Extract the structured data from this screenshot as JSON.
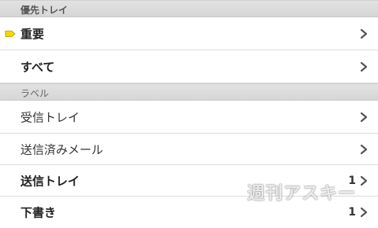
{
  "sections": {
    "priority_header": "優先トレイ",
    "label_header": "ラベル"
  },
  "rows": [
    {
      "label": "重要",
      "count": ""
    },
    {
      "label": "すべて",
      "count": ""
    },
    {
      "label": "受信トレイ",
      "count": ""
    },
    {
      "label": "送信済みメール",
      "count": ""
    },
    {
      "label": "送信トレイ",
      "count": "1"
    },
    {
      "label": "下書き",
      "count": "1"
    }
  ],
  "watermark": "週刊アスキー",
  "colors": {
    "important_marker": "#f5d800",
    "header_bg": "#dcdcdc"
  }
}
